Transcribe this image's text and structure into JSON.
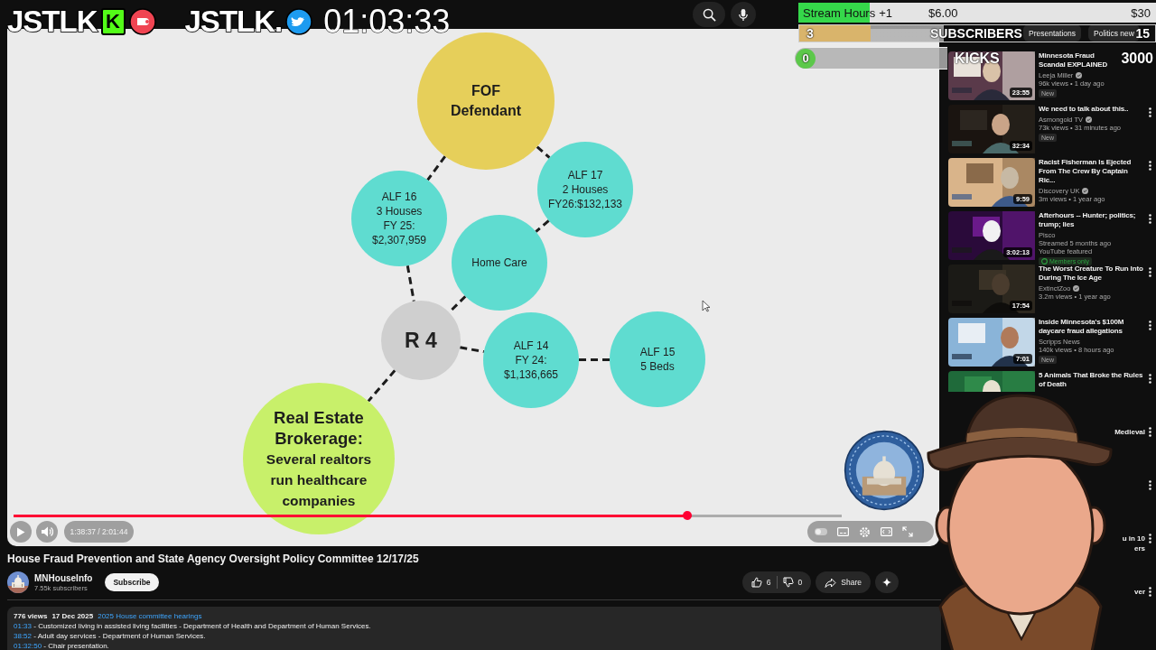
{
  "stream_overlay": {
    "logos": [
      {
        "kind": "kick",
        "text": "JSTLK",
        "badge": "K"
      },
      {
        "kind": "bird",
        "text": "JSTLK."
      }
    ],
    "timer": "01:03:33",
    "goals": [
      {
        "kind": "money",
        "label": "Stream Hours",
        "step": "+1",
        "amount": "$6.00",
        "goal": "$30",
        "level": 0.2
      },
      {
        "kind": "count",
        "count": "3",
        "label": "SUBSCRIBERS",
        "goal": "15",
        "level": 0.2
      },
      {
        "kind": "pill",
        "count": "0",
        "label": "KICKS",
        "goal": "3000",
        "level": 0
      }
    ]
  },
  "video": {
    "diagram": {
      "nodes": [
        {
          "kind": "defendant",
          "color": "#e6cf5a",
          "heading": [
            "FOF",
            "Defendant"
          ]
        },
        {
          "kind": "facility",
          "color": "#5fdcd0",
          "lines": [
            "ALF 16",
            "3 Houses",
            "FY 25:",
            "$2,307,959"
          ]
        },
        {
          "kind": "facility",
          "color": "#5fdcd0",
          "lines": [
            "ALF 17",
            "2 Houses",
            "FY26:$132,133"
          ]
        },
        {
          "kind": "facility",
          "color": "#5fdcd0",
          "lines": [
            "Home Care"
          ]
        },
        {
          "kind": "hub",
          "color": "#cfcfcf",
          "heading": [
            "R 4"
          ]
        },
        {
          "kind": "facility",
          "color": "#5fdcd0",
          "lines": [
            "ALF 14",
            "FY 24:",
            "$1,136,665"
          ]
        },
        {
          "kind": "facility",
          "color": "#5fdcd0",
          "lines": [
            "ALF 15",
            "5 Beds"
          ]
        },
        {
          "kind": "brokerage",
          "color": "#c8f06a",
          "heading": [
            "Real Estate",
            "Brokerage:"
          ],
          "lines": [
            "Several realtors",
            "run healthcare",
            "companies"
          ]
        }
      ]
    },
    "player": {
      "progress": {
        "level": 0.814
      },
      "time": "1:38:37 / 2:01:44"
    }
  },
  "video_info": {
    "title": "House Fraud Prevention and State Agency Oversight Policy Committee 12/17/25",
    "channel": "MNHouseInfo",
    "subscribers": "7.55k subscribers",
    "subscribe": "Subscribe",
    "likes": "6",
    "dislikes": "0",
    "share": "Share",
    "description": {
      "views": "776 views",
      "date": "17 Dec 2025",
      "playlist": "2025 House committee hearings",
      "chapters": [
        {
          "time": "01:33",
          "text": "- Customized living in assisted living facilities - Department of Health and Department of Human Services."
        },
        {
          "time": "38:52",
          "text": "- Adult day services - Department of Human Services."
        },
        {
          "time": "01:32:50",
          "text": "- Chair presentation."
        }
      ]
    }
  },
  "sidebar": {
    "chips": [
      "Presentations",
      "Politics new"
    ],
    "videos": [
      {
        "kind": "video",
        "title": "Minnesota Fraud Scandal EXPLAINED",
        "channel": "Leeja Miller",
        "verified": true,
        "meta": "96k views • 1 day ago",
        "badge": {
          "kind": "new",
          "text": "New"
        },
        "duration": "23:55"
      },
      {
        "kind": "video",
        "title": "We need to talk about this..",
        "channel": "Asmongold TV",
        "verified": true,
        "meta": "73k views • 31 minutes ago",
        "badge": {
          "kind": "new",
          "text": "New"
        },
        "duration": "32:34"
      },
      {
        "kind": "video",
        "title": "Racist Fisherman Is Ejected From The Crew By Captain Ric...",
        "channel": "Discovery UK",
        "verified": true,
        "meta": "3m views • 1 year ago",
        "duration": "9:59"
      },
      {
        "kind": "video",
        "title": "Afterhours -- Hunter; politics; trump; lies",
        "channel": "Pisco",
        "verified": false,
        "meta": "Streamed 5 months ago",
        "featured": "YouTube featured",
        "badge": {
          "kind": "members",
          "text": "Members only"
        },
        "duration": "3:02:13"
      },
      {
        "kind": "video",
        "title": "The Worst Creature To Run Into During The Ice Age",
        "channel": "ExtinctZoo",
        "verified": true,
        "meta": "3.2m views • 1 year ago",
        "duration": "17:54"
      },
      {
        "kind": "video",
        "title": "Inside Minnesota's $100M daycare fraud allegations",
        "channel": "Scripps News",
        "verified": false,
        "meta": "140k views • 8 hours ago",
        "badge": {
          "kind": "new",
          "text": "New"
        },
        "duration": "7:01"
      },
      {
        "kind": "video",
        "title": "5 Animals That Broke the Rules of Death"
      },
      {
        "kind": "covered",
        "fragments": [
          "Medieval"
        ]
      },
      {
        "kind": "covered"
      },
      {
        "kind": "covered",
        "fragments": [
          "u in 10",
          "ers"
        ]
      },
      {
        "kind": "covered",
        "fragments": [
          "ver"
        ]
      }
    ]
  }
}
